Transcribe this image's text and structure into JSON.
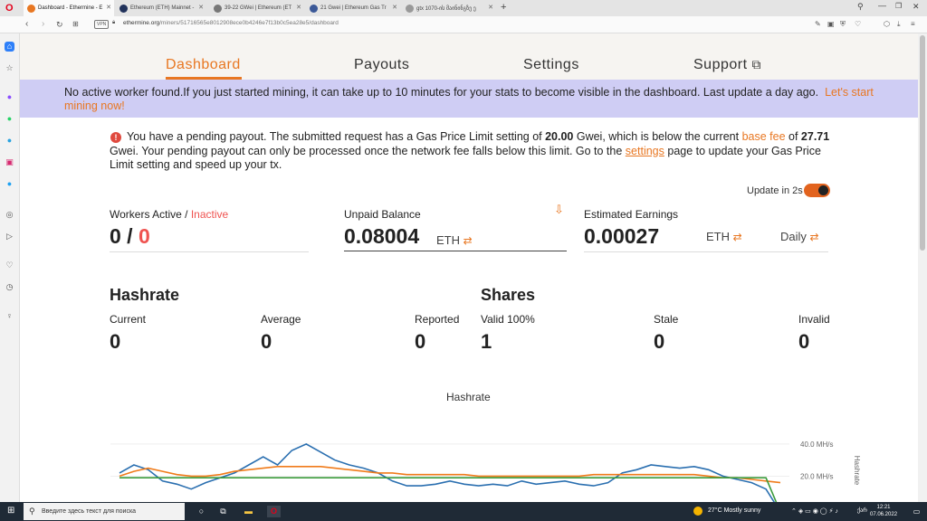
{
  "browser": {
    "tabs": [
      {
        "title": "Dashboard - Ethermine - E",
        "active": true
      },
      {
        "title": "Ethereum (ETH) Mainnet -",
        "active": false
      },
      {
        "title": "39-22 GWei | Ethereum (ET",
        "active": false
      },
      {
        "title": "21 Gwei | Ethereum Gas Tr",
        "active": false
      },
      {
        "title": "gtx 1070-ის მაინინგზე ე",
        "active": false
      }
    ],
    "new_tab": "+",
    "vpn_label": "VPN",
    "url_host": "ethermine.org",
    "url_path": "/miners/51716565e8012908ece0b4246e7f13b0c5ea28e5/dashboard"
  },
  "nav": {
    "dashboard": "Dashboard",
    "payouts": "Payouts",
    "settings": "Settings",
    "support": "Support"
  },
  "banner": {
    "text": "No active worker found.If you just started mining, it can take up to 10 minutes for your stats to become visible in the dashboard. Last update a day ago.",
    "link": "Let's start mining now!"
  },
  "payout_notice": {
    "part1": "You have a pending payout. The submitted request has a Gas Price Limit setting of ",
    "limit": "20.00",
    "part2": " Gwei, which is below the current ",
    "base_fee_link": "base fee",
    "part3": " of ",
    "base_fee": "27.71",
    "part4": " Gwei. Your pending payout can only be processed once the network fee falls below this limit. Go to the ",
    "settings_link": "settings",
    "part5": " page to update your Gas Price Limit setting and speed up your tx."
  },
  "update": {
    "label": "Update in 2s",
    "enabled": true
  },
  "stats": {
    "workers_label": "Workers Active / ",
    "inactive_label": "Inactive",
    "workers_active": "0",
    "slash": " / ",
    "workers_inactive": "0",
    "unpaid_label": "Unpaid Balance",
    "unpaid_value": "0.08004",
    "unpaid_unit": "ETH",
    "estimated_label": "Estimated Earnings",
    "estimated_value": "0.00027",
    "estimated_unit": "ETH",
    "period": "Daily"
  },
  "hashrate": {
    "title": "Hashrate",
    "current_label": "Current",
    "current": "0",
    "average_label": "Average",
    "average": "0",
    "reported_label": "Reported",
    "reported": "0"
  },
  "shares": {
    "title": "Shares",
    "valid_label": "Valid 100%",
    "valid": "1",
    "stale_label": "Stale",
    "stale": "0",
    "invalid_label": "Invalid",
    "invalid": "0"
  },
  "chart_data": {
    "type": "line",
    "title": "Hashrate",
    "ylabel": "Hashrate",
    "yticks": [
      "40.0 MH/s",
      "20.0 MH/s"
    ],
    "ylim": [
      0,
      45
    ],
    "grid": true,
    "series": [
      {
        "color": "#2a6fb0",
        "values": [
          22,
          27,
          24,
          17,
          15,
          12,
          16,
          19,
          22,
          27,
          32,
          27,
          36,
          40,
          35,
          30,
          27,
          25,
          22,
          17,
          14,
          14,
          15,
          17,
          15,
          14,
          15,
          14,
          17,
          15,
          16,
          17,
          15,
          14,
          16,
          22,
          24,
          27,
          26,
          25,
          26,
          24,
          20,
          18,
          16,
          12,
          0
        ]
      },
      {
        "color": "#f07b1a",
        "values": [
          20,
          23,
          25,
          23,
          21,
          20,
          20,
          21,
          23,
          24,
          25,
          26,
          26,
          26,
          26,
          25,
          24,
          23,
          22,
          22,
          21,
          21,
          21,
          21,
          21,
          20,
          20,
          20,
          20,
          20,
          20,
          20,
          20,
          21,
          21,
          21,
          21,
          21,
          21,
          21,
          21,
          20,
          19,
          19,
          18,
          17,
          16
        ]
      },
      {
        "color": "#3a9a3a",
        "values": [
          19,
          19,
          19,
          19,
          19,
          19,
          19,
          19,
          19,
          19,
          19,
          19,
          19,
          19,
          19,
          19,
          19,
          19,
          19,
          19,
          19,
          19,
          19,
          19,
          19,
          19,
          19,
          19,
          19,
          19,
          19,
          19,
          19,
          19,
          19,
          19,
          19,
          19,
          19,
          19,
          19,
          19,
          19,
          19,
          19,
          19,
          0
        ]
      }
    ]
  },
  "taskbar": {
    "search_placeholder": "Введите здесь текст для поиска",
    "weather": "27°C  Mostly sunny",
    "lang": "ქარ",
    "time": "12:21",
    "date": "07.06.2022"
  }
}
